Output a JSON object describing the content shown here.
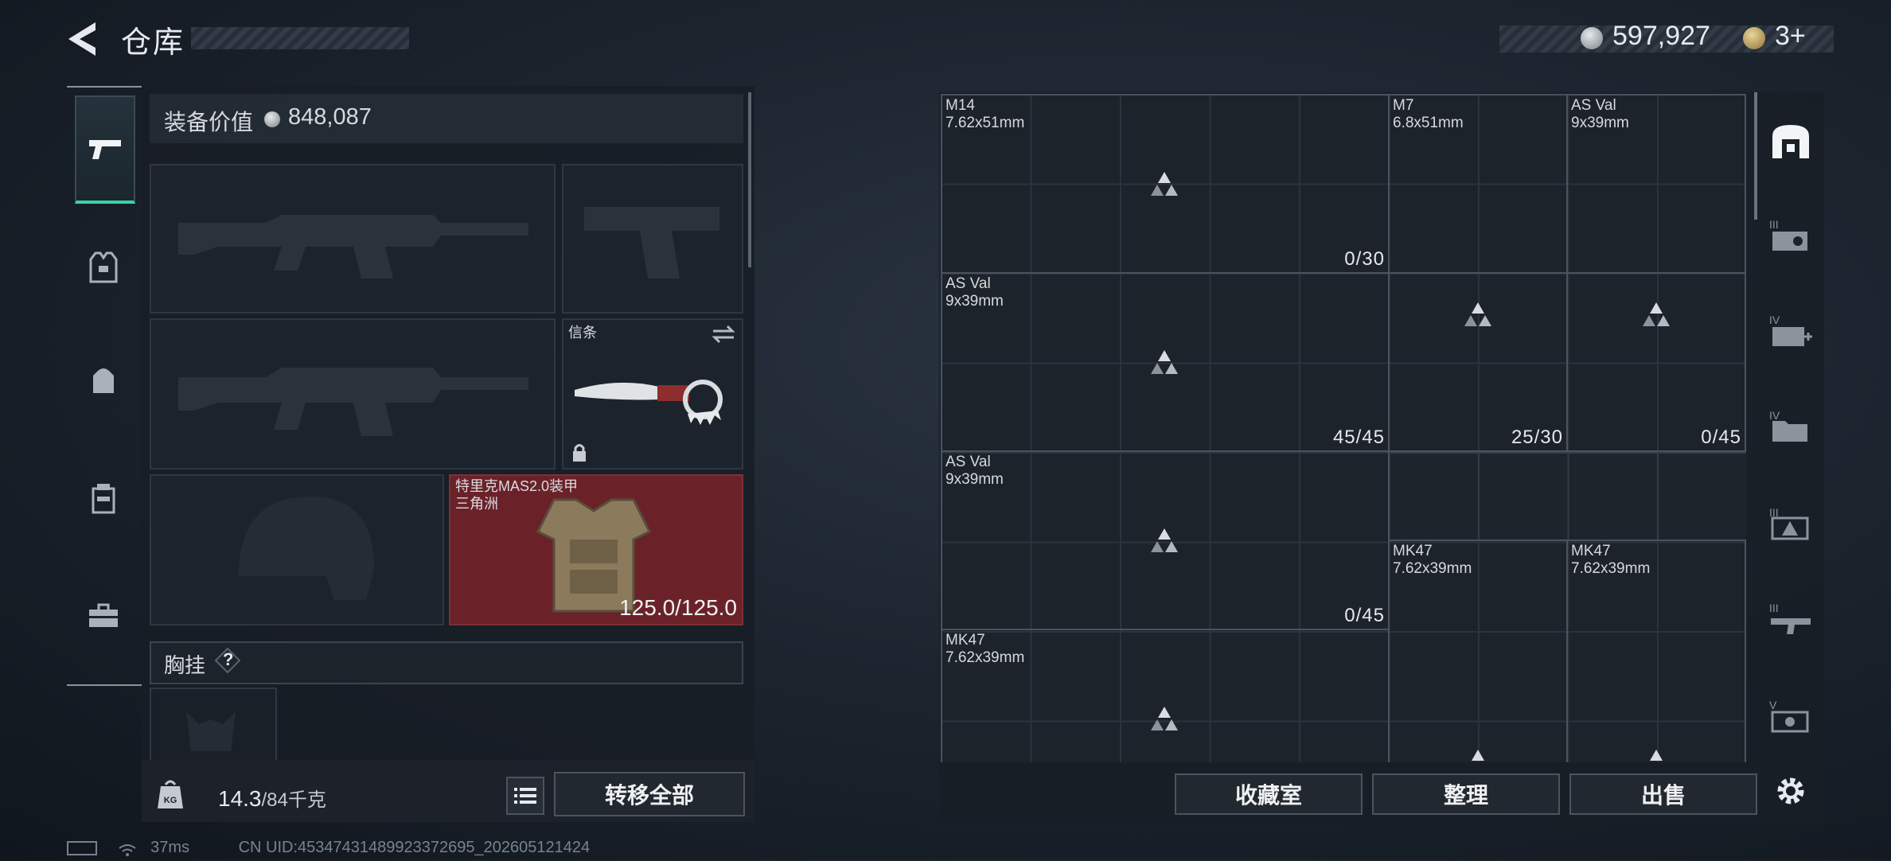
{
  "header": {
    "title": "仓库",
    "back_icon": "back-arrow-icon"
  },
  "currency": {
    "coin_value": "597,927",
    "bond_value": "3+"
  },
  "equipment": {
    "value_label": "装备价值",
    "value": "848,087",
    "melee_label": "信条",
    "armor_name": "特里克MAS2.0装甲",
    "armor_faction": "三角洲",
    "armor_durability": "125.0/125.0",
    "chest_rig_label": "胸挂",
    "help_text": "?"
  },
  "weight": {
    "current": "14.3",
    "max": "/84千克"
  },
  "buttons": {
    "transfer_all": "转移全部",
    "collection": "收藏室",
    "sort": "整理",
    "sell": "出售"
  },
  "status": {
    "ping": "37ms",
    "uid": "CN UID:45347431489923372695_202605121424"
  },
  "storage_items": [
    {
      "name": "M14",
      "caliber": "7.62x51mm",
      "count": "0/30"
    },
    {
      "name": "M7",
      "caliber": "6.8x51mm",
      "count": ""
    },
    {
      "name": "AS Val",
      "caliber": "9x39mm",
      "count": ""
    },
    {
      "name": "AS Val",
      "caliber": "9x39mm",
      "count": "45/45"
    },
    {
      "name": "",
      "caliber": "",
      "count": "25/30"
    },
    {
      "name": "",
      "caliber": "",
      "count": "0/45"
    },
    {
      "name": "AS Val",
      "caliber": "9x39mm",
      "count": "0/45"
    },
    {
      "name": "MK47",
      "caliber": "7.62x39mm",
      "count": ""
    },
    {
      "name": "MK47",
      "caliber": "7.62x39mm",
      "count": ""
    },
    {
      "name": "MK47",
      "caliber": "7.62x39mm",
      "count": ""
    }
  ],
  "side_tabs": [
    "storage-main-icon",
    "tier-3-case-icon",
    "tier-4-medical-icon",
    "tier-4-folder-icon",
    "tier-3-triangle-case-icon",
    "tier-3-gun-case-icon",
    "tier-5-display-case-icon",
    "settings-gear-icon"
  ],
  "colors": {
    "accent": "#3bd4a0",
    "armor_bg": "#6a2228"
  }
}
